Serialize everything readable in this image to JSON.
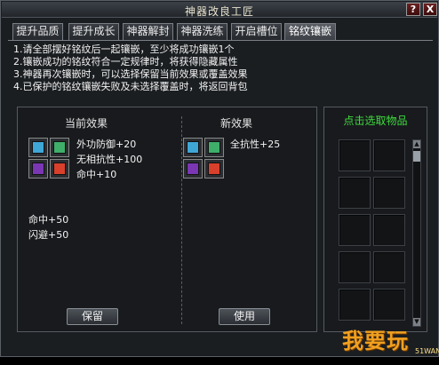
{
  "window": {
    "title": "神器改良工匠"
  },
  "titlebar_buttons": {
    "help": "?",
    "close": "X"
  },
  "tabs": [
    {
      "label": "提升品质"
    },
    {
      "label": "提升成长"
    },
    {
      "label": "神器解封"
    },
    {
      "label": "神器洗练"
    },
    {
      "label": "开启槽位"
    },
    {
      "label": "铭纹镶嵌",
      "active": true
    }
  ],
  "instructions": [
    "1.请全部摆好铭纹后一起镶嵌，至少将成功镶嵌1个",
    "2.镶嵌成功的铭纹符合一定规律时，将获得隐藏属性",
    "3.神器再次镶嵌时，可以选择保留当前效果或覆盖效果",
    "4.已保护的铭纹镶嵌失败及未选择覆盖时，将返回背包"
  ],
  "current": {
    "title": "当前效果",
    "stats": [
      "外功防御+20",
      "无相抗性+100",
      "命中+10"
    ],
    "hidden_stats": [
      "命中+50",
      "闪避+50"
    ],
    "button": "保留",
    "gems": [
      "#3fa7d6",
      "#3fae6a",
      "#7a36b3",
      "#d8402c"
    ]
  },
  "new": {
    "title": "新效果",
    "stats": [
      "全抗性+25"
    ],
    "button": "使用",
    "gems": [
      "#3fa7d6",
      "#3fae6a",
      "#7a36b3",
      "#d8402c"
    ]
  },
  "items": {
    "title": "点击选取物品"
  },
  "watermark": {
    "logo": "我要玩",
    "site": "51WAN"
  }
}
